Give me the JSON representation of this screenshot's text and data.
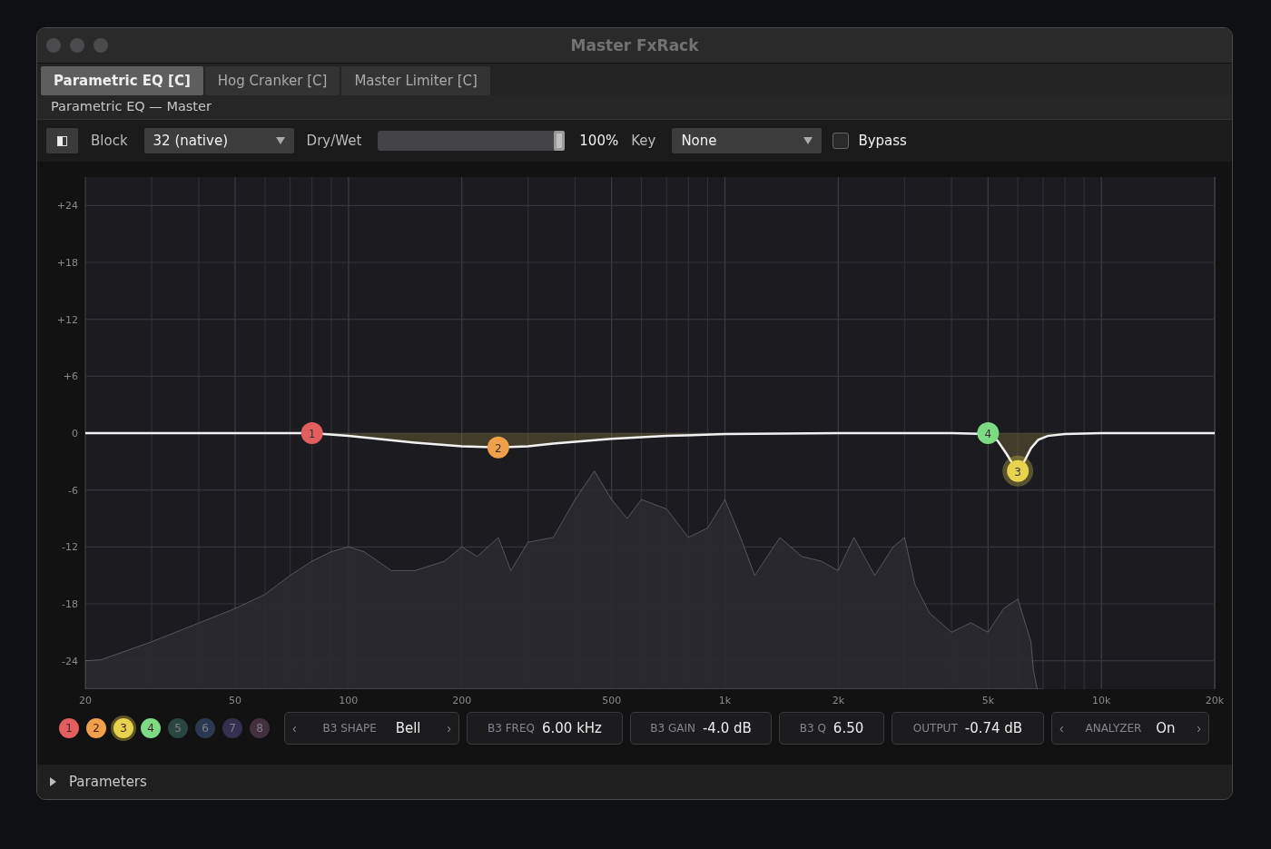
{
  "window": {
    "title": "Master FxRack"
  },
  "tabs": [
    {
      "label": "Parametric EQ [C]",
      "selected": true
    },
    {
      "label": "Hog Cranker [C]",
      "selected": false
    },
    {
      "label": "Master Limiter [C]",
      "selected": false
    }
  ],
  "subtitle": "Parametric EQ — Master",
  "toolbar": {
    "block_label": "Block",
    "block_value": "32 (native)",
    "drywet_label": "Dry/Wet",
    "drywet": {
      "level": 1.0
    },
    "drywet_reading": "100%",
    "key_label": "Key",
    "key_value": "None",
    "bypass": {
      "label": "Bypass",
      "checked": false
    }
  },
  "eq_plot": {
    "y_labels": [
      "+24",
      "+18",
      "+12",
      "+6",
      "0",
      "-6",
      "-12",
      "-18",
      "-24"
    ],
    "x_labels": [
      "20",
      "50",
      "100",
      "200",
      "500",
      "1k",
      "2k",
      "5k",
      "10k",
      "20k"
    ],
    "nodes": [
      {
        "label": "1"
      },
      {
        "label": "2"
      },
      {
        "label": "3"
      },
      {
        "label": "4"
      }
    ]
  },
  "bands": [
    {
      "label": "1",
      "color": "#e35f5f",
      "selected": false,
      "enabled": true
    },
    {
      "label": "2",
      "color": "#f0a04b",
      "selected": false,
      "enabled": true
    },
    {
      "label": "3",
      "color": "#e8d34e",
      "selected": true,
      "enabled": true
    },
    {
      "label": "4",
      "color": "#7ddc83",
      "selected": false,
      "enabled": true
    },
    {
      "label": "5",
      "color": "#2b4640",
      "selected": false,
      "enabled": false
    },
    {
      "label": "6",
      "color": "#2b3950",
      "selected": false,
      "enabled": false
    },
    {
      "label": "7",
      "color": "#353050",
      "selected": false,
      "enabled": false
    },
    {
      "label": "8",
      "color": "#42303e",
      "selected": false,
      "enabled": false
    }
  ],
  "params": [
    {
      "kind": "stepper",
      "label": "B3 SHAPE",
      "value": "Bell",
      "prev": "‹",
      "next": "›"
    },
    {
      "kind": "value",
      "label": "B3 FREQ",
      "value": "6.00 kHz"
    },
    {
      "kind": "value",
      "label": "B3 GAIN",
      "value": "-4.0 dB"
    },
    {
      "kind": "value",
      "label": "B3 Q",
      "value": "6.50"
    },
    {
      "kind": "value",
      "label": "OUTPUT",
      "value": "-0.74 dB"
    },
    {
      "kind": "stepper",
      "label": "ANALYZER",
      "value": "On",
      "prev": "‹",
      "next": "›"
    }
  ],
  "parameters_section": {
    "label": "Parameters",
    "expanded": false
  }
}
